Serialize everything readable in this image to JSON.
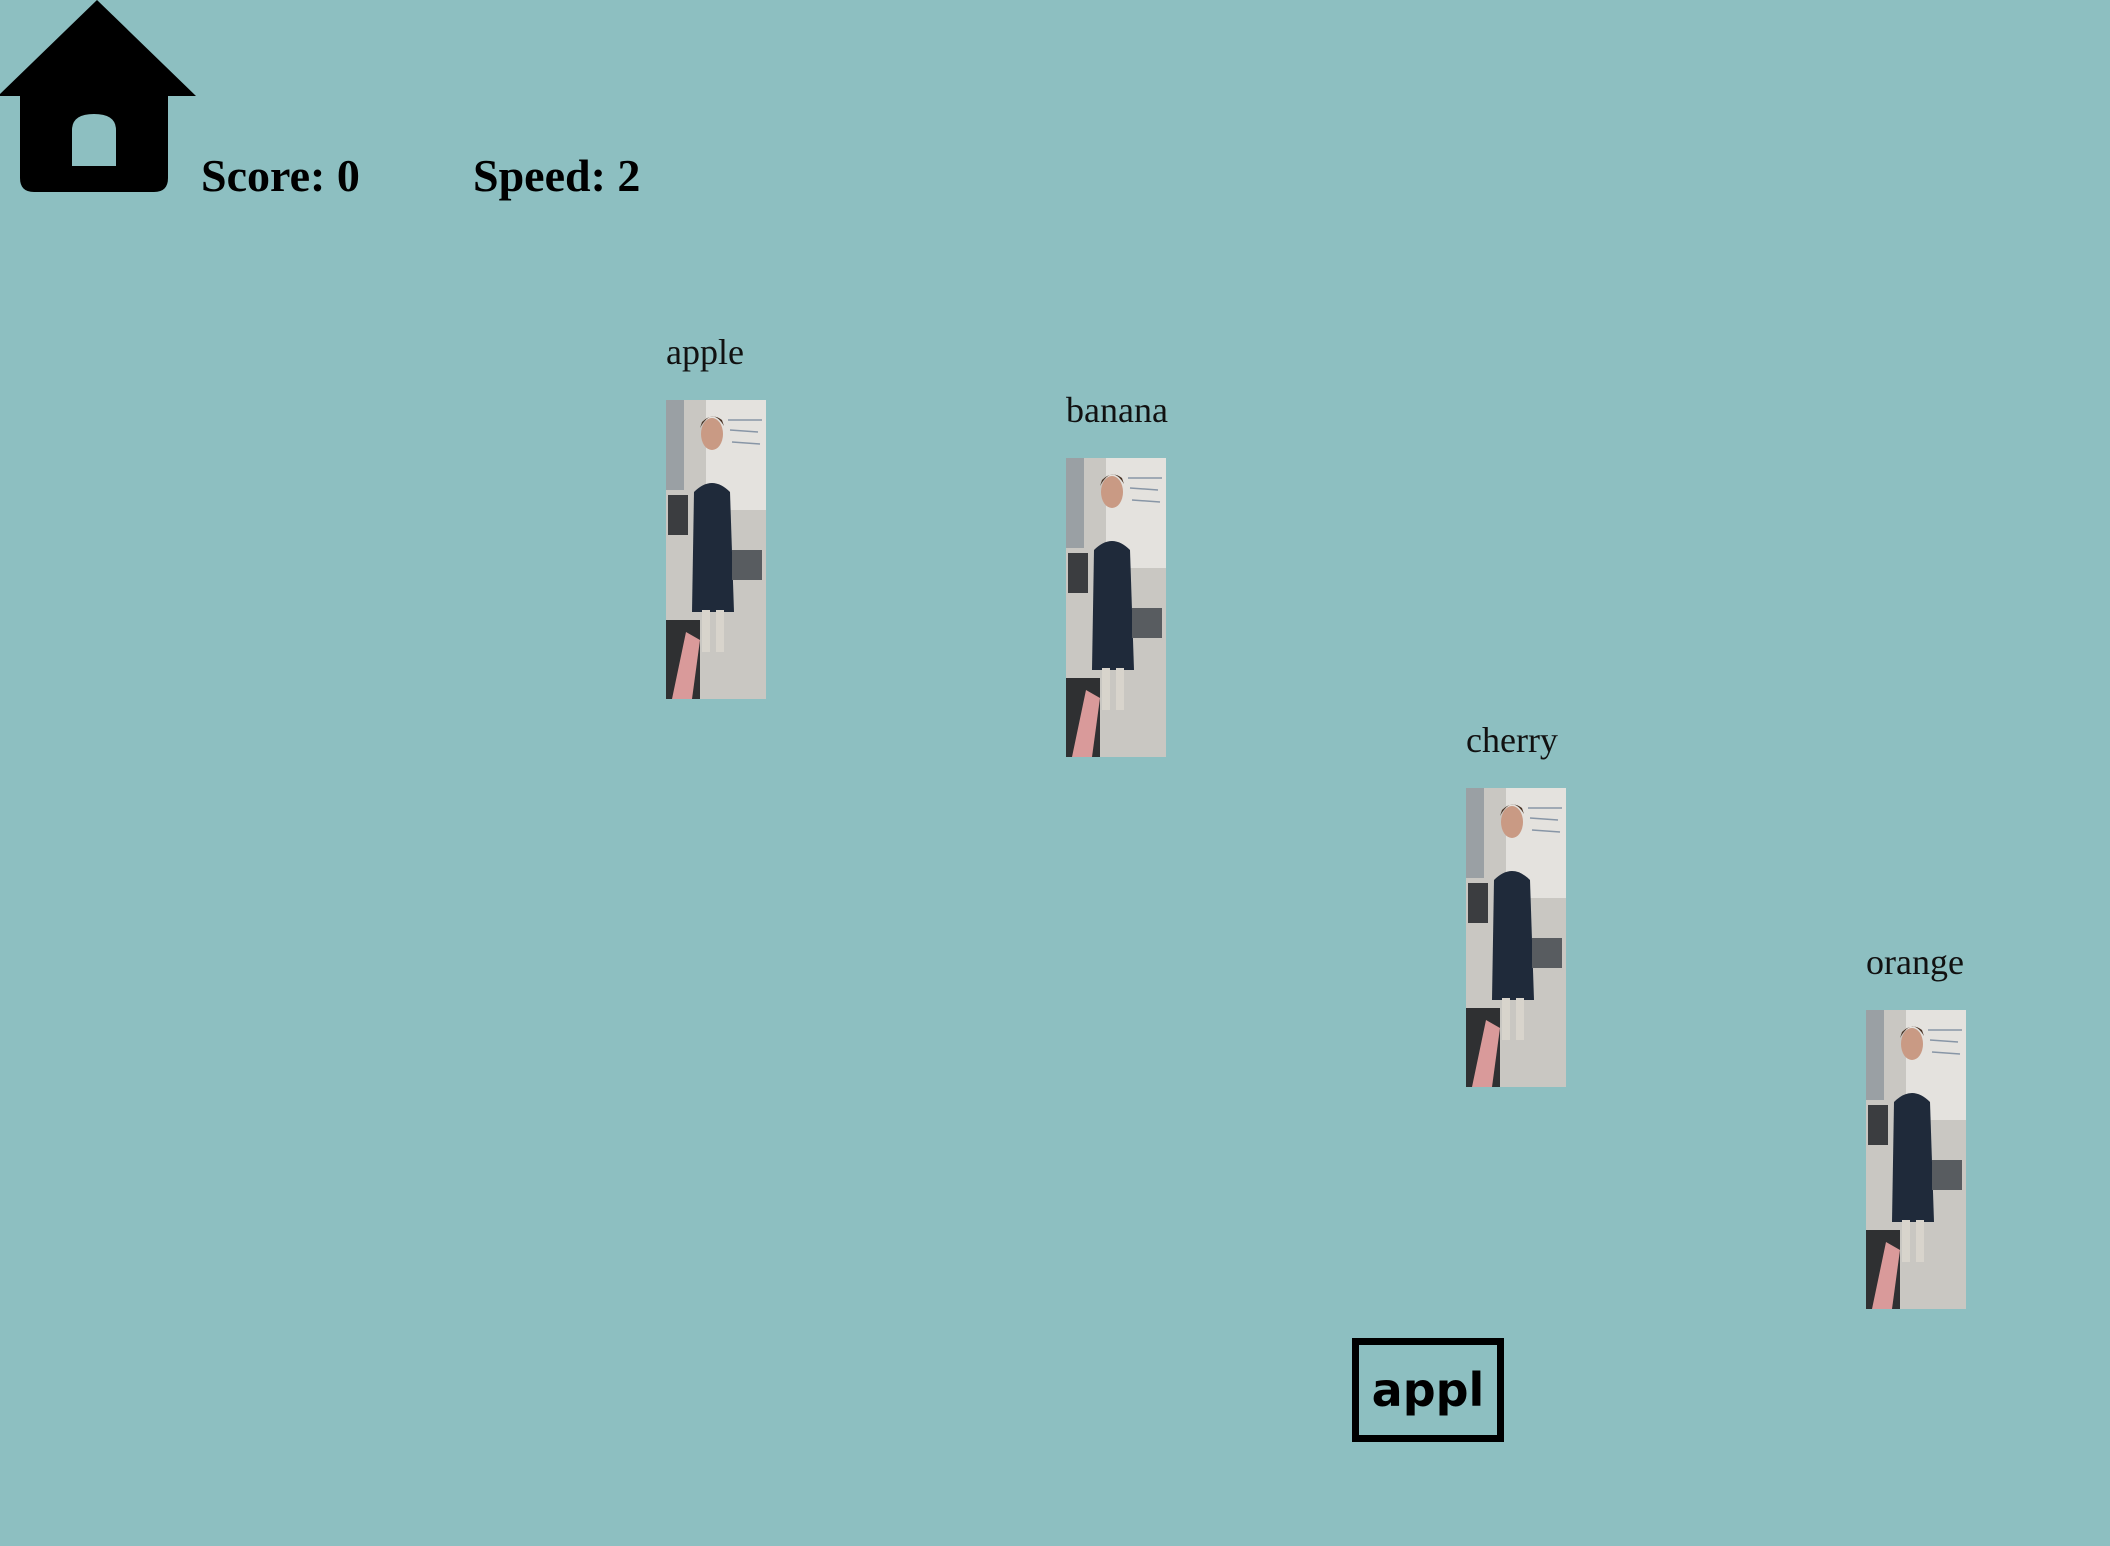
{
  "app": {
    "background_color": "#8dbfc1",
    "home_icon": "home-icon"
  },
  "hud": {
    "score_text": "Score: 0",
    "speed_text": "Speed: 2"
  },
  "falling_words": [
    {
      "word": "apple",
      "image": "person-photo"
    },
    {
      "word": "banana",
      "image": "person-photo"
    },
    {
      "word": "cherry",
      "image": "person-photo"
    },
    {
      "word": "orange",
      "image": "person-photo"
    }
  ],
  "input": {
    "typed_text": "appl"
  }
}
